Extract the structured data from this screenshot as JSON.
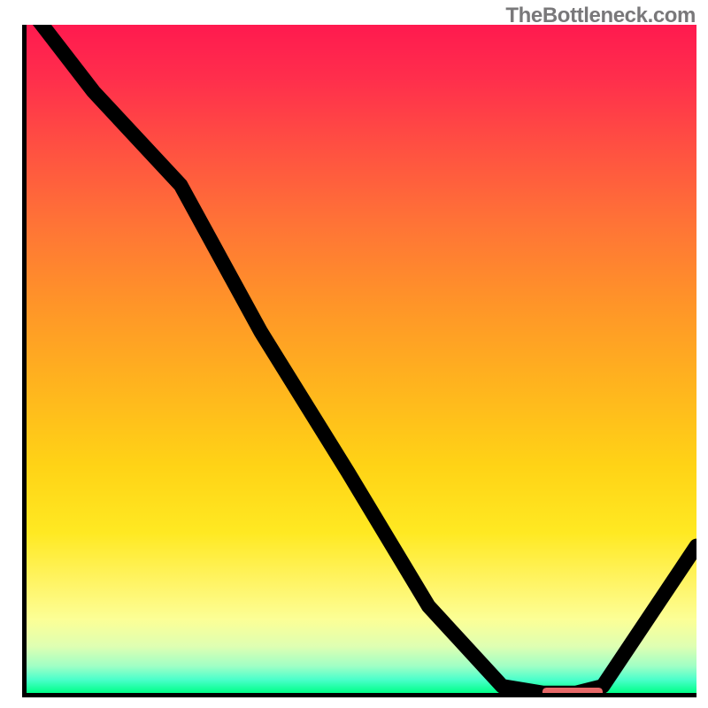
{
  "watermark": "TheBottleneck.com",
  "chart_data": {
    "type": "line",
    "title": "",
    "xlabel": "",
    "ylabel": "",
    "xlim": [
      0,
      100
    ],
    "ylim": [
      0,
      100
    ],
    "grid": false,
    "annotations": [],
    "series": [
      {
        "name": "bottleneck-curve",
        "x": [
          0,
          10,
          23,
          35,
          48,
          60,
          71,
          77,
          82,
          86,
          90,
          100
        ],
        "values": [
          103,
          90,
          76,
          54,
          33,
          13,
          1,
          0,
          0,
          1,
          7,
          22
        ]
      }
    ],
    "marker": {
      "name": "optimal-range",
      "x0": 77,
      "x1": 86,
      "y": 0
    },
    "background_gradient": {
      "stops": [
        {
          "pos": 0,
          "color": "#ff1a4f"
        },
        {
          "pos": 50,
          "color": "#ffb41e"
        },
        {
          "pos": 80,
          "color": "#fff56a"
        },
        {
          "pos": 100,
          "color": "#00ff88"
        }
      ]
    }
  }
}
